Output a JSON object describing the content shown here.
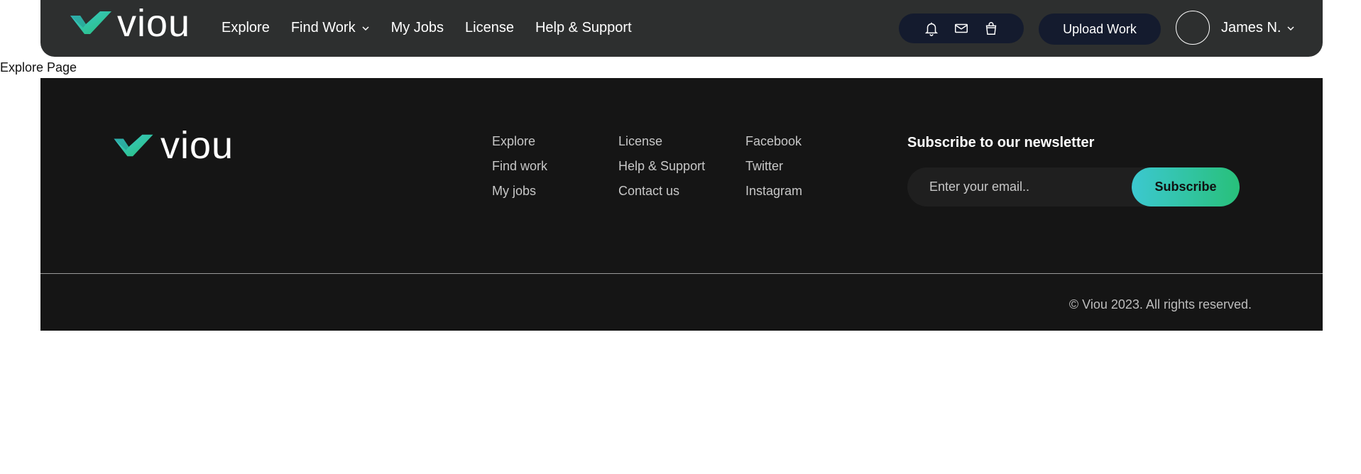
{
  "brand": {
    "name": "viou",
    "accent_teal": "#3cc8d0",
    "accent_green": "#28c07a",
    "navbar_bg": "#2d2f2f",
    "footer_bg": "#151515",
    "pill_bg": "#141b2e"
  },
  "nav": {
    "links": [
      {
        "label": "Explore",
        "has_dropdown": false
      },
      {
        "label": "Find Work",
        "has_dropdown": true
      },
      {
        "label": "My Jobs",
        "has_dropdown": false
      },
      {
        "label": "License",
        "has_dropdown": false
      },
      {
        "label": "Help & Support",
        "has_dropdown": false
      }
    ],
    "icons": [
      "bell-icon",
      "mail-icon",
      "bag-icon"
    ],
    "upload_label": "Upload Work",
    "user_name": "James N."
  },
  "page": {
    "label": "Explore Page"
  },
  "footer": {
    "columns": [
      [
        "Explore",
        "Find work",
        "My jobs"
      ],
      [
        "License",
        "Help & Support",
        "Contact us"
      ],
      [
        "Facebook",
        "Twitter",
        "Instagram"
      ]
    ],
    "newsletter_title": "Subscribe to our newsletter",
    "email_placeholder": "Enter your email..",
    "subscribe_label": "Subscribe",
    "copyright": "© Viou 2023. All rights reserved."
  }
}
